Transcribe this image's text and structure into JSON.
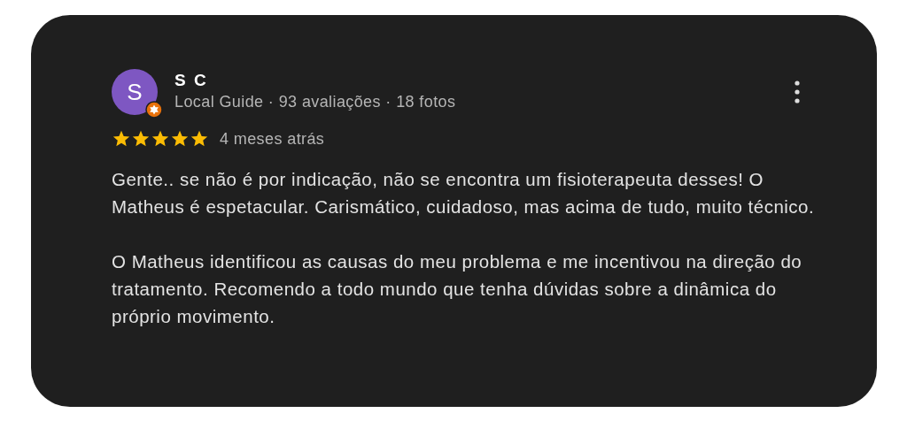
{
  "review": {
    "avatar_letter": "S",
    "local_guide_badge": true,
    "author": "S C",
    "meta": "Local Guide · 93 avaliações · 18 fotos",
    "stars": 5,
    "time": "4 meses atrás",
    "paragraphs": [
      "Gente.. se não é por indicação, não se encontra um fisioterapeuta desses! O Matheus é espetacular. Carismático, cuidadoso, mas acima de tudo, muito técnico.",
      "O Matheus identificou as causas do meu problema e me incentivou na direção do tratamento. Recomendo a todo mundo que tenha dúvidas sobre a dinâmica do próprio movimento."
    ]
  }
}
